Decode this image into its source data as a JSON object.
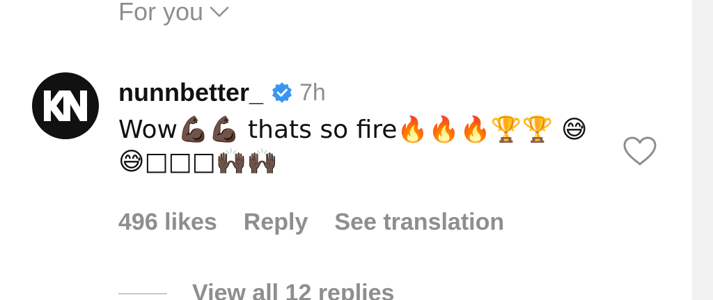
{
  "sort": {
    "label": "For you",
    "icon": "chevron-down-icon"
  },
  "comment": {
    "username": "nunnbetter_",
    "verified_icon": "verified-badge-icon",
    "time": "7h",
    "text": "Wow💪🏿💪🏿 thats so fire🔥🔥🔥🏆🏆 😅😅□□□🙌🏿🙌🏿",
    "avatar_icon": "kn-logo-avatar",
    "like_icon": "heart-icon"
  },
  "actions": {
    "likes": "496 likes",
    "reply": "Reply",
    "translate": "See translation"
  },
  "replies": {
    "label": "View all 12 replies"
  },
  "colors": {
    "text": "#111111",
    "muted": "#8e8e8e",
    "verified": "#3897f0",
    "avatar_bg": "#111111"
  }
}
